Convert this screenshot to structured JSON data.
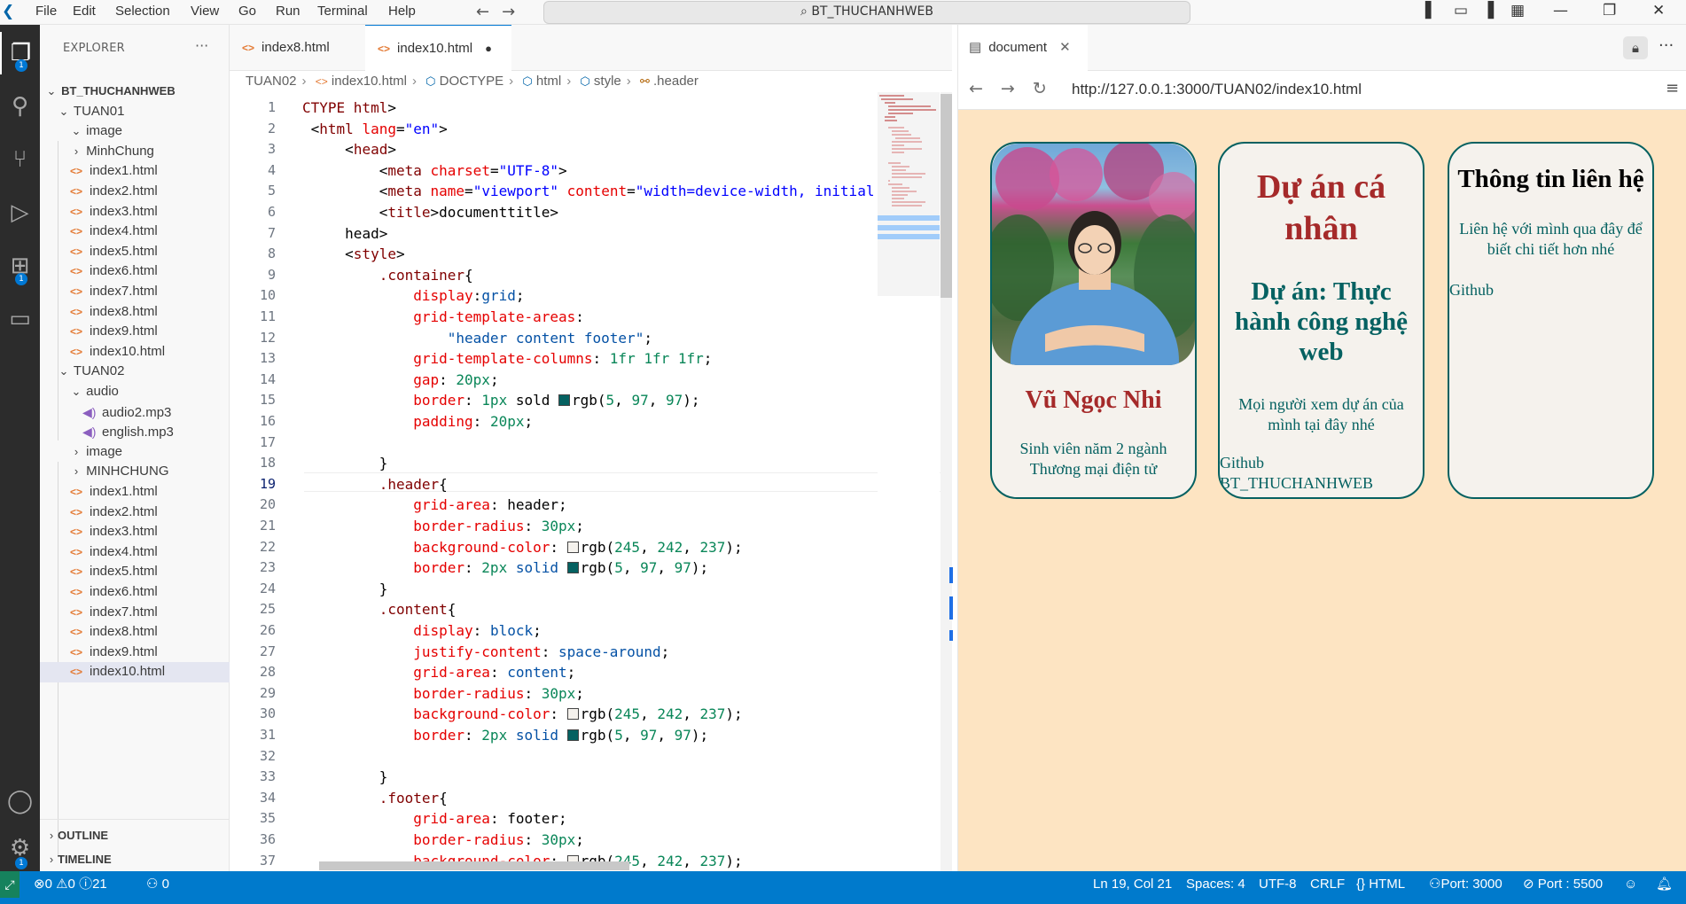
{
  "titlebar": {
    "menu": [
      "File",
      "Edit",
      "Selection",
      "View",
      "Go",
      "Run",
      "Terminal",
      "Help"
    ],
    "search": "BT_THUCHANHWEB"
  },
  "activity": {
    "explorer_badge": "1",
    "extensions_badge": "1",
    "settings_badge": "1"
  },
  "sidebar": {
    "title": "EXPLORER",
    "root": "BT_THUCHANHWEB",
    "tuan01": {
      "folder": "TUAN01",
      "items": [
        "image",
        "MinhChung",
        "index1.html",
        "index2.html",
        "index3.html",
        "index4.html",
        "index5.html",
        "index6.html",
        "index7.html",
        "index8.html",
        "index9.html",
        "index10.html"
      ]
    },
    "tuan02": {
      "folder": "TUAN02",
      "audio": "audio",
      "audio_items": [
        "audio2.mp3",
        "english.mp3"
      ],
      "items": [
        "image",
        "MINHCHUNG",
        "index1.html",
        "index2.html",
        "index3.html",
        "index4.html",
        "index5.html",
        "index6.html",
        "index7.html",
        "index8.html",
        "index9.html",
        "index10.html"
      ]
    },
    "outline": "OUTLINE",
    "timeline": "TIMELINE"
  },
  "editor": {
    "tabs": [
      "index8.html",
      "index10.html"
    ],
    "breadcrumb": [
      "TUAN02",
      "index10.html",
      "DOCTYPE",
      "html",
      "style",
      ".header"
    ],
    "current_line": 19
  },
  "browser": {
    "tab_title": "document",
    "url": "http://127.0.0.1:3000/TUAN02/index10.html",
    "card1": {
      "name": "Vũ Ngọc Nhi",
      "desc": "Sinh viên năm 2 ngành Thương mại điện tử"
    },
    "card2": {
      "title": "Dự án cá nhân",
      "subtitle": "Dự án: Thực hành công nghệ web",
      "desc": "Mọi người xem dự án của mình tại đây nhé",
      "link1": "Github",
      "link2": "BT_THUCHANHWEB"
    },
    "card3": {
      "title": "Thông tin liên hệ",
      "desc": "Liên hệ với mình qua đây để biết chi tiết hơn nhé",
      "link": "Github"
    },
    "colors": {
      "background": "#fde4c2",
      "card_bg": "#f5f2ed",
      "border": "#056161",
      "heading": "#a52a2a"
    }
  },
  "status": {
    "errors": "0",
    "warnings": "0",
    "infos": "21",
    "ports": "0",
    "position": "Ln 19, Col 21",
    "spaces": "Spaces: 4",
    "encoding": "UTF-8",
    "eol": "CRLF",
    "language": "HTML",
    "port": "Port: 3000",
    "port2": "Port : 5500"
  }
}
